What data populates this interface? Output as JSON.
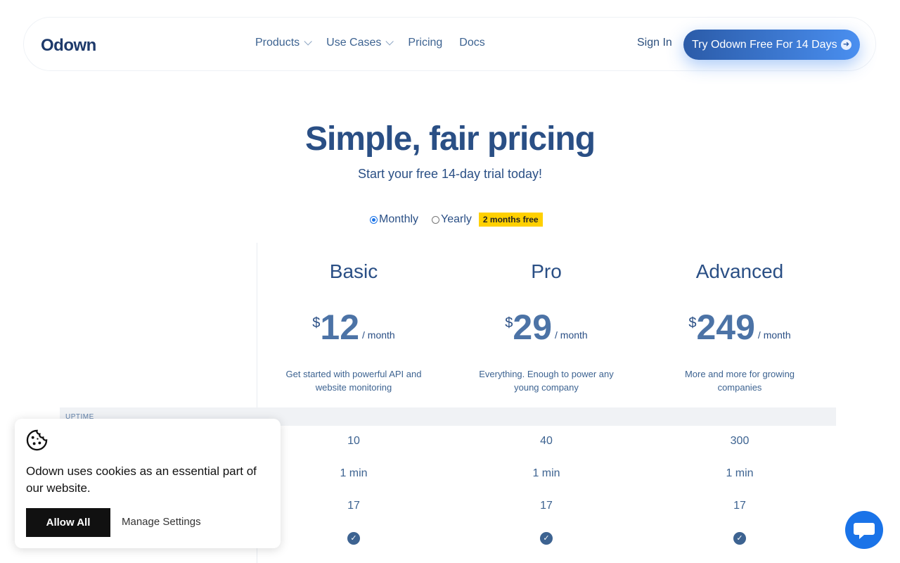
{
  "nav": {
    "logo": "Odown",
    "links": [
      {
        "label": "Products",
        "dropdown": true
      },
      {
        "label": "Use Cases",
        "dropdown": true
      },
      {
        "label": "Pricing",
        "dropdown": false
      },
      {
        "label": "Docs",
        "dropdown": false
      }
    ],
    "sign_in": "Sign In",
    "cta": "Try Odown Free For 14 Days"
  },
  "hero": {
    "title": "Simple, fair pricing",
    "subtitle": "Start your free 14-day trial today!"
  },
  "billing": {
    "monthly": "Monthly",
    "yearly": "Yearly",
    "badge": "2 months free",
    "selected": "Monthly"
  },
  "plans": [
    {
      "name": "Basic",
      "currency": "$",
      "price": "12",
      "period": "/ month",
      "description": "Get started with powerful API and website monitoring"
    },
    {
      "name": "Pro",
      "currency": "$",
      "price": "29",
      "period": "/ month",
      "description": "Everything. Enough to power any young company"
    },
    {
      "name": "Advanced",
      "currency": "$",
      "price": "249",
      "period": "/ month",
      "description": "More and more for growing companies"
    }
  ],
  "section": {
    "label": "UPTIME",
    "rows": [
      {
        "values": [
          "10",
          "40",
          "300"
        ]
      },
      {
        "values": [
          "1 min",
          "1 min",
          "1 min"
        ]
      },
      {
        "values": [
          "17",
          "17",
          "17"
        ]
      },
      {
        "values": [
          "check",
          "check",
          "check"
        ]
      }
    ]
  },
  "cookie": {
    "text": "Odown uses cookies as an essential part of our website.",
    "allow": "Allow All",
    "manage": "Manage Settings"
  },
  "colors": {
    "brand": "#2a4f85",
    "accent": "#1a73e8",
    "badge": "#ffd000"
  }
}
